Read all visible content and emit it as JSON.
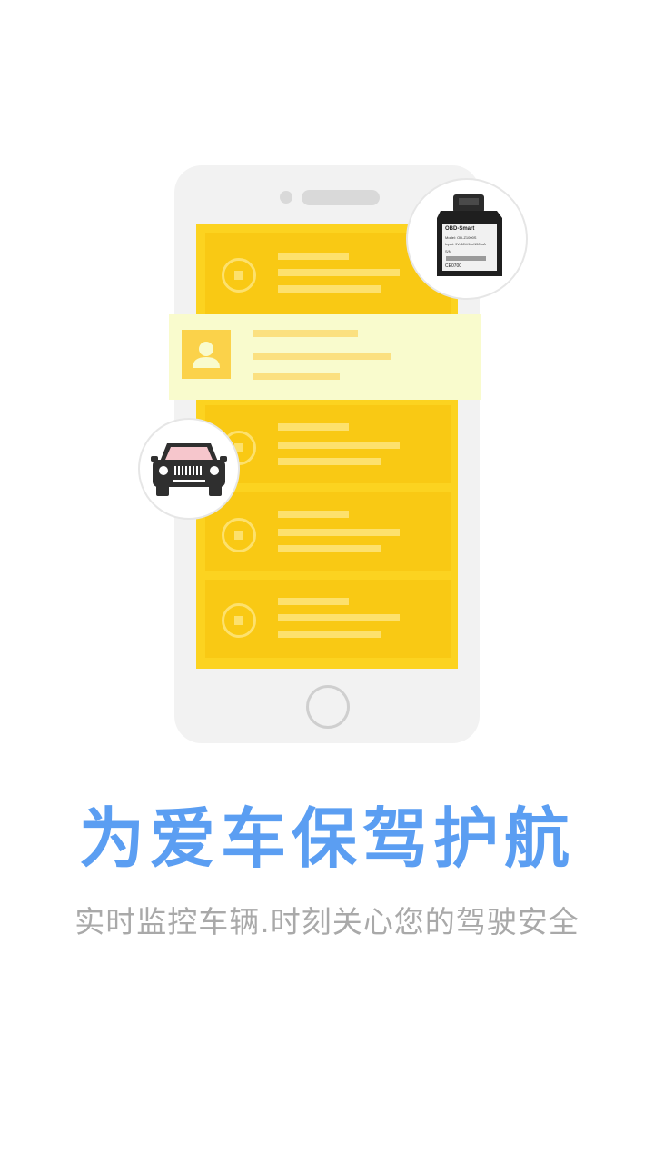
{
  "headline": "为爱车保驾护航",
  "subheadline": "实时监控车辆.时刻关心您的驾驶安全",
  "obd_device": {
    "brand_label": "OBD-Smart",
    "model_line": "Model: OD-Z1000S",
    "input_line": "Input: 9V-36V/4m/150mA",
    "sn_label": "S/N",
    "cert_label": "CE0700"
  },
  "icons": {
    "device": "obd-device-icon",
    "car": "car-icon",
    "avatar": "person-icon"
  },
  "colors": {
    "accent": "#5b9ef2",
    "screen_yellow": "#fcd320",
    "subtitle_gray": "#a9a9a9"
  }
}
